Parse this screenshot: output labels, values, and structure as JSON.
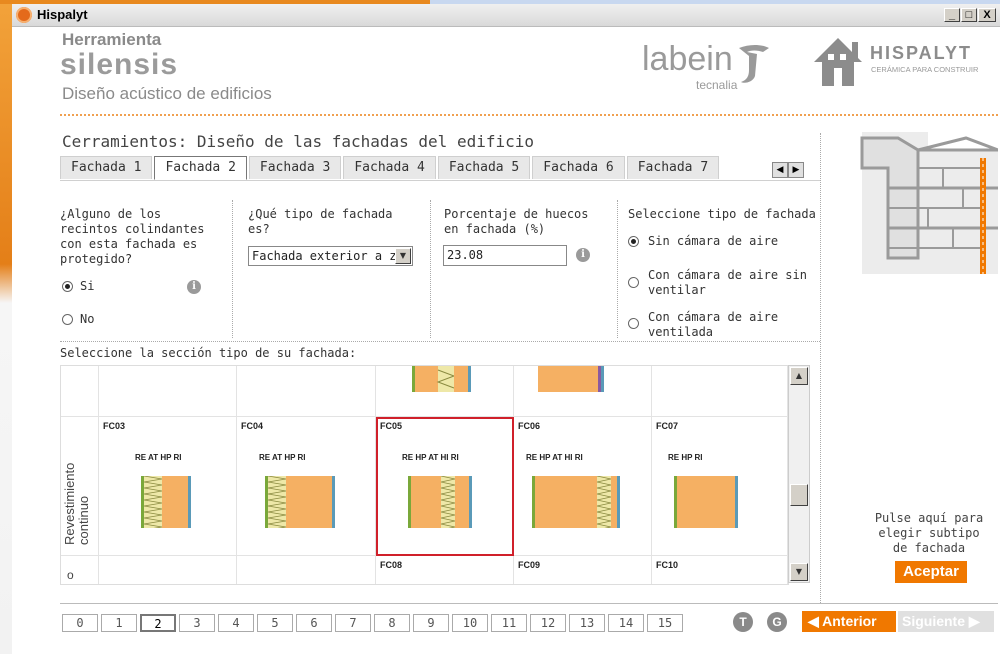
{
  "window": {
    "title": "Hispalyt",
    "buttons": [
      "_",
      "□",
      "X"
    ]
  },
  "header": {
    "herramienta": "Herramienta",
    "silensis": "silensis",
    "subtitle": "Diseño acústico de edificios",
    "labein": "labein",
    "tecnalia": "tecnalia",
    "hispalyt": "HISPALYT",
    "hispalyt_sub": "CERÁMICA PARA CONSTRUIR"
  },
  "section_title": "Cerramientos: Diseño de las fachadas del edificio",
  "tabs": [
    "Fachada 1",
    "Fachada 2",
    "Fachada 3",
    "Fachada 4",
    "Fachada 5",
    "Fachada 6",
    "Fachada 7"
  ],
  "active_tab": "Fachada 2",
  "tab_arrows": {
    "left": "◀",
    "right": "▶"
  },
  "q1": {
    "lines": [
      "¿Alguno de los",
      "recintos colindantes",
      "con esta fachada es",
      "protegido?"
    ],
    "options": [
      "Si",
      "No"
    ],
    "selected": "Si",
    "info": "i"
  },
  "q2": {
    "lines": [
      "¿Qué tipo de fachada",
      "es?"
    ],
    "value": "Fachada exterior a z",
    "dropdown": "▼"
  },
  "q3": {
    "lines": [
      "Porcentaje de huecos",
      "en fachada (%)"
    ],
    "value": "23.08",
    "info": "i"
  },
  "q4": {
    "title": "Seleccione tipo de fachada",
    "options": [
      [
        "Sin cámara de aire"
      ],
      [
        "Con cámara de aire sin",
        "ventilar"
      ],
      [
        "Con cámara de aire",
        "ventilada"
      ]
    ],
    "selected": 0
  },
  "grid_prompt": "Seleccione la sección tipo de su fachada:",
  "row_label": "Revestimiento continuo",
  "row_label_next": "o",
  "grid_cells": [
    {
      "code": "FC03",
      "labels": [
        "RE",
        "AT",
        "HP",
        "RI"
      ],
      "selected": false
    },
    {
      "code": "FC04",
      "labels": [
        "RE",
        "AT",
        "HP",
        "RI"
      ],
      "selected": false
    },
    {
      "code": "FC05",
      "labels": [
        "RE",
        "HP",
        "AT",
        "HI",
        "RI"
      ],
      "selected": true
    },
    {
      "code": "FC06",
      "labels": [
        "RE",
        "HP",
        "AT",
        "HI",
        "RI"
      ],
      "selected": false
    },
    {
      "code": "FC07",
      "labels": [
        "RE",
        "HP",
        "RI"
      ],
      "selected": false
    }
  ],
  "grid_next_codes": [
    "FC08",
    "FC09",
    "FC10"
  ],
  "scroll": {
    "up": "▲",
    "down": "▼"
  },
  "pulse_lines": [
    "Pulse aquí para",
    "elegir subtipo",
    "de fachada"
  ],
  "aceptar": "Aceptar",
  "pages": [
    "0",
    "1",
    "2",
    "3",
    "4",
    "5",
    "6",
    "7",
    "8",
    "9",
    "10",
    "11",
    "12",
    "13",
    "14",
    "15"
  ],
  "current_page": "2",
  "circle_t": "T",
  "circle_g": "G",
  "anterior": "◀ Anterior",
  "siguiente": "Siguiente ▶",
  "colors": {
    "orange": "#f07800",
    "wall": "#f5b063",
    "insulation": "#e8e0a0",
    "selected_border": "#d0202a"
  }
}
